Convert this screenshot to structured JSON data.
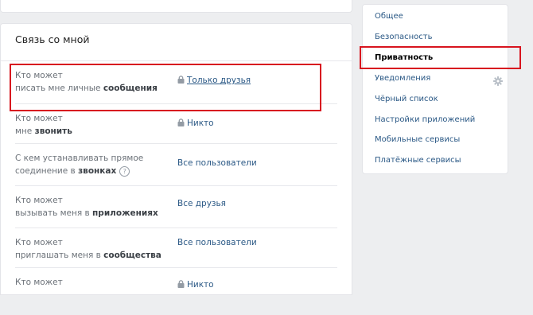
{
  "privacy": {
    "section_title": "Связь со мной",
    "rows": [
      {
        "q1": "Кто может",
        "q2_pre": "писать мне личные ",
        "q2_bold": "сообщения",
        "q2_post": "",
        "value": "Только друзья",
        "lock": true,
        "help": false
      },
      {
        "q1": "Кто может",
        "q2_pre": "мне ",
        "q2_bold": "звонить",
        "q2_post": "",
        "value": "Никто",
        "lock": true,
        "help": false
      },
      {
        "q1": "С кем устанавливать прямое",
        "q2_pre": "соединение в ",
        "q2_bold": "звонках",
        "q2_post": "",
        "value": "Все пользователи",
        "lock": false,
        "help": true
      },
      {
        "q1": "Кто может",
        "q2_pre": "вызывать меня в ",
        "q2_bold": "приложениях",
        "q2_post": "",
        "value": "Все друзья",
        "lock": false,
        "help": false
      },
      {
        "q1": "Кто может",
        "q2_pre": "приглашать меня в ",
        "q2_bold": "сообщества",
        "q2_post": "",
        "value": "Все пользователи",
        "lock": false,
        "help": false
      },
      {
        "q1": "Кто может",
        "value": "Никто",
        "lock": true
      }
    ]
  },
  "sidebar": {
    "items": [
      {
        "label": "Общее"
      },
      {
        "label": "Безопасность"
      },
      {
        "label": "Приватность"
      },
      {
        "label": "Уведомления"
      },
      {
        "label": "Чёрный список"
      },
      {
        "label": "Настройки приложений"
      },
      {
        "label": "Мобильные сервисы"
      },
      {
        "label": "Платёжные сервисы"
      }
    ],
    "active_index": 2
  },
  "colors": {
    "highlight": "#d8141f",
    "link": "#2a5885"
  },
  "icons": {
    "lock": "lock-icon",
    "help": "help-icon",
    "gear": "gear-icon"
  }
}
